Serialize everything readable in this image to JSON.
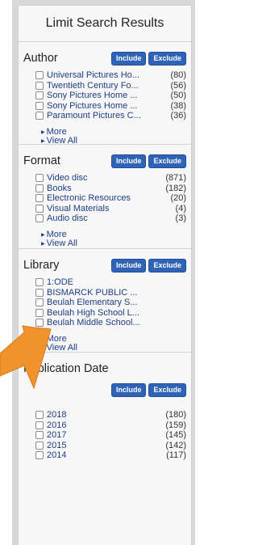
{
  "title": "Limit Search Results",
  "include_label": "Include",
  "exclude_label": "Exclude",
  "more_label": "More",
  "view_all_label": "View All",
  "facets": {
    "author": {
      "name": "Author",
      "items": [
        {
          "label": "Universal Pictures Ho...",
          "count": "(80)"
        },
        {
          "label": "Twentieth Century Fo...",
          "count": "(56)"
        },
        {
          "label": "Sony Pictures Home ...",
          "count": "(50)"
        },
        {
          "label": "Sony Pictures Home ...",
          "count": "(38)"
        },
        {
          "label": "Paramount Pictures C...",
          "count": "(36)"
        }
      ]
    },
    "format": {
      "name": "Format",
      "items": [
        {
          "label": "Video disc",
          "count": "(871)"
        },
        {
          "label": "Books",
          "count": "(182)"
        },
        {
          "label": "Electronic Resources",
          "count": "(20)"
        },
        {
          "label": "Visual Materials",
          "count": "(4)"
        },
        {
          "label": "Audio disc",
          "count": "(3)"
        }
      ]
    },
    "library": {
      "name": "Library",
      "items": [
        {
          "label": "1:ODE",
          "count": ""
        },
        {
          "label": "BISMARCK PUBLIC ...",
          "count": ""
        },
        {
          "label": "Beulah Elementary S...",
          "count": ""
        },
        {
          "label": "Beulah High School L...",
          "count": ""
        },
        {
          "label": "Beulah Middle School...",
          "count": ""
        }
      ]
    },
    "publication_date": {
      "name": "Publication Date",
      "items": [
        {
          "label": "2018",
          "count": "(180)"
        },
        {
          "label": "2016",
          "count": "(159)"
        },
        {
          "label": "2017",
          "count": "(145)"
        },
        {
          "label": "2015",
          "count": "(142)"
        },
        {
          "label": "2014",
          "count": "(117)"
        }
      ]
    }
  },
  "colors": {
    "button": "#2e63b8",
    "link": "#1d3d86",
    "arrow": "#f0922e"
  }
}
